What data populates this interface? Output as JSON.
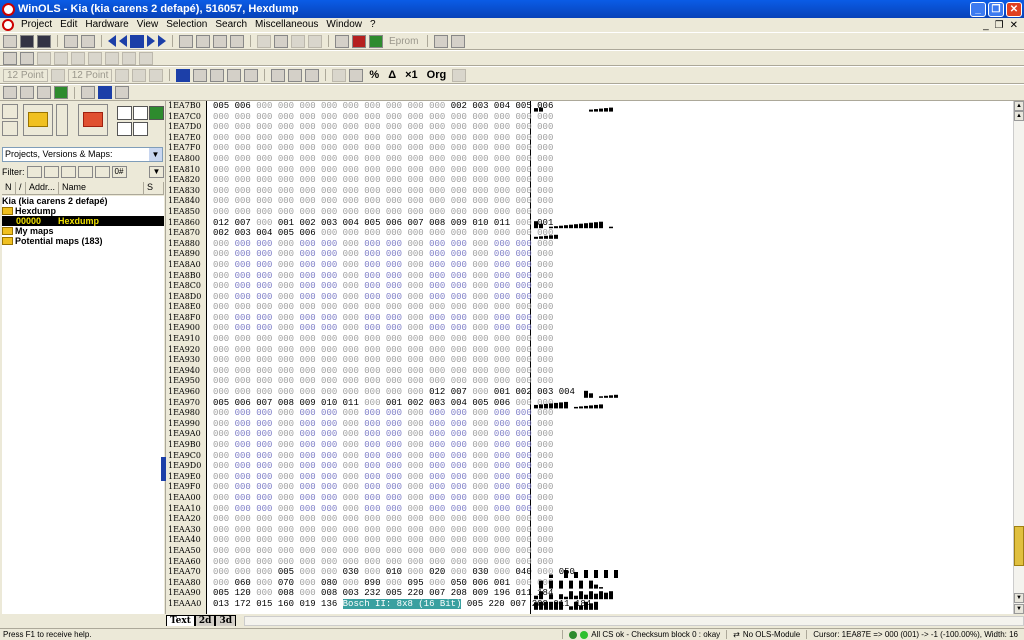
{
  "window": {
    "title": "WinOLS - Kia (kia carens 2 defapé), 516057, Hexdump",
    "minimize": "_",
    "restore": "❐",
    "close": "✕"
  },
  "menu": {
    "items": [
      "Project",
      "Edit",
      "Hardware",
      "View",
      "Selection",
      "Search",
      "Miscellaneous",
      "Window",
      "?"
    ],
    "mdi_controls": [
      "_",
      "❐",
      "✕"
    ]
  },
  "toolbar": {
    "eprom_label": "Eprom",
    "font_size_1": "12 Point",
    "font_size_2": "12 Point",
    "btn_x1": "×1",
    "btn_org": "Org",
    "btn_percent": "%"
  },
  "projects": {
    "combo_value": "Projects, Versions & Maps:",
    "filter_label": "Filter:",
    "filter_btn_0": "0#",
    "columns": [
      "N",
      "/",
      "Addr...",
      "Name",
      "S"
    ],
    "tree": {
      "project": "Kia (kia carens 2 defapé)",
      "hexdump_folder": "Hexdump",
      "hexdump_addr": "00000",
      "hexdump_name": "Hexdump",
      "my_maps": "My maps",
      "potential_maps": "Potential maps (183)"
    }
  },
  "hex": {
    "addresses": [
      "1EA7B0",
      "1EA7C0",
      "1EA7D0",
      "1EA7E0",
      "1EA7F0",
      "1EA800",
      "1EA810",
      "1EA820",
      "1EA830",
      "1EA840",
      "1EA850",
      "1EA860",
      "1EA870",
      "1EA880",
      "1EA890",
      "1EA8A0",
      "1EA8B0",
      "1EA8C0",
      "1EA8D0",
      "1EA8E0",
      "1EA8F0",
      "1EA900",
      "1EA910",
      "1EA920",
      "1EA930",
      "1EA940",
      "1EA950",
      "1EA960",
      "1EA970",
      "1EA980",
      "1EA990",
      "1EA9A0",
      "1EA9B0",
      "1EA9C0",
      "1EA9D0",
      "1EA9E0",
      "1EA9F0",
      "1EAA00",
      "1EAA10",
      "1EAA20",
      "1EAA30",
      "1EAA40",
      "1EAA50",
      "1EAA60",
      "1EAA70",
      "1EAA80",
      "1EAA90",
      "1EAAA0"
    ],
    "rows": [
      [
        "005",
        "006",
        "000",
        "000",
        "000",
        "000",
        "000",
        "000",
        "000",
        "000",
        "000",
        "002",
        "003",
        "004",
        "005",
        "006"
      ],
      [
        "000",
        "000",
        "000",
        "000",
        "000",
        "000",
        "000",
        "000",
        "000",
        "000",
        "000",
        "000",
        "000",
        "000",
        "000",
        "000"
      ],
      [
        "000",
        "000",
        "000",
        "000",
        "000",
        "000",
        "000",
        "000",
        "000",
        "000",
        "000",
        "000",
        "000",
        "000",
        "000",
        "000"
      ],
      [
        "000",
        "000",
        "000",
        "000",
        "000",
        "000",
        "000",
        "000",
        "000",
        "000",
        "000",
        "000",
        "000",
        "000",
        "000",
        "000"
      ],
      [
        "000",
        "000",
        "000",
        "000",
        "000",
        "000",
        "000",
        "000",
        "000",
        "000",
        "000",
        "000",
        "000",
        "000",
        "000",
        "000"
      ],
      [
        "000",
        "000",
        "000",
        "000",
        "000",
        "000",
        "000",
        "000",
        "000",
        "000",
        "000",
        "000",
        "000",
        "000",
        "000",
        "000"
      ],
      [
        "000",
        "000",
        "000",
        "000",
        "000",
        "000",
        "000",
        "000",
        "000",
        "000",
        "000",
        "000",
        "000",
        "000",
        "000",
        "000"
      ],
      [
        "000",
        "000",
        "000",
        "000",
        "000",
        "000",
        "000",
        "000",
        "000",
        "000",
        "000",
        "000",
        "000",
        "000",
        "000",
        "000"
      ],
      [
        "000",
        "000",
        "000",
        "000",
        "000",
        "000",
        "000",
        "000",
        "000",
        "000",
        "000",
        "000",
        "000",
        "000",
        "000",
        "000"
      ],
      [
        "000",
        "000",
        "000",
        "000",
        "000",
        "000",
        "000",
        "000",
        "000",
        "000",
        "000",
        "000",
        "000",
        "000",
        "000",
        "000"
      ],
      [
        "000",
        "000",
        "000",
        "000",
        "000",
        "000",
        "000",
        "000",
        "000",
        "000",
        "000",
        "000",
        "000",
        "000",
        "000",
        "000"
      ],
      [
        "012",
        "007",
        "000",
        "001",
        "002",
        "003",
        "004",
        "005",
        "006",
        "007",
        "008",
        "009",
        "010",
        "011",
        "000",
        "001"
      ],
      [
        "002",
        "003",
        "004",
        "005",
        "006",
        "000",
        "000",
        "000",
        "000",
        "000",
        "000",
        "000",
        "000",
        "000",
        "000",
        "000"
      ],
      [
        "000",
        "000",
        "000",
        "000",
        "000",
        "000",
        "000",
        "000",
        "000",
        "000",
        "000",
        "000",
        "000",
        "000",
        "000",
        "000"
      ],
      [
        "000",
        "000",
        "000",
        "000",
        "000",
        "000",
        "000",
        "000",
        "000",
        "000",
        "000",
        "000",
        "000",
        "000",
        "000",
        "000"
      ],
      [
        "000",
        "000",
        "000",
        "000",
        "000",
        "000",
        "000",
        "000",
        "000",
        "000",
        "000",
        "000",
        "000",
        "000",
        "000",
        "000"
      ],
      [
        "000",
        "000",
        "000",
        "000",
        "000",
        "000",
        "000",
        "000",
        "000",
        "000",
        "000",
        "000",
        "000",
        "000",
        "000",
        "000"
      ],
      [
        "000",
        "000",
        "000",
        "000",
        "000",
        "000",
        "000",
        "000",
        "000",
        "000",
        "000",
        "000",
        "000",
        "000",
        "000",
        "000"
      ],
      [
        "000",
        "000",
        "000",
        "000",
        "000",
        "000",
        "000",
        "000",
        "000",
        "000",
        "000",
        "000",
        "000",
        "000",
        "000",
        "000"
      ],
      [
        "000",
        "000",
        "000",
        "000",
        "000",
        "000",
        "000",
        "000",
        "000",
        "000",
        "000",
        "000",
        "000",
        "000",
        "000",
        "000"
      ],
      [
        "000",
        "000",
        "000",
        "000",
        "000",
        "000",
        "000",
        "000",
        "000",
        "000",
        "000",
        "000",
        "000",
        "000",
        "000",
        "000"
      ],
      [
        "000",
        "000",
        "000",
        "000",
        "000",
        "000",
        "000",
        "000",
        "000",
        "000",
        "000",
        "000",
        "000",
        "000",
        "000",
        "000"
      ],
      [
        "000",
        "000",
        "000",
        "000",
        "000",
        "000",
        "000",
        "000",
        "000",
        "000",
        "000",
        "000",
        "000",
        "000",
        "000",
        "000"
      ],
      [
        "000",
        "000",
        "000",
        "000",
        "000",
        "000",
        "000",
        "000",
        "000",
        "000",
        "000",
        "000",
        "000",
        "000",
        "000",
        "000"
      ],
      [
        "000",
        "000",
        "000",
        "000",
        "000",
        "000",
        "000",
        "000",
        "000",
        "000",
        "000",
        "000",
        "000",
        "000",
        "000",
        "000"
      ],
      [
        "000",
        "000",
        "000",
        "000",
        "000",
        "000",
        "000",
        "000",
        "000",
        "000",
        "000",
        "000",
        "000",
        "000",
        "000",
        "000"
      ],
      [
        "000",
        "000",
        "000",
        "000",
        "000",
        "000",
        "000",
        "000",
        "000",
        "000",
        "000",
        "000",
        "000",
        "000",
        "000",
        "000"
      ],
      [
        "000",
        "000",
        "000",
        "000",
        "000",
        "000",
        "000",
        "000",
        "000",
        "000",
        "012",
        "007",
        "000",
        "001",
        "002",
        "003",
        "004"
      ],
      [
        "005",
        "006",
        "007",
        "008",
        "009",
        "010",
        "011",
        "000",
        "001",
        "002",
        "003",
        "004",
        "005",
        "006",
        "000",
        "000"
      ],
      [
        "000",
        "000",
        "000",
        "000",
        "000",
        "000",
        "000",
        "000",
        "000",
        "000",
        "000",
        "000",
        "000",
        "000",
        "000",
        "000"
      ],
      [
        "000",
        "000",
        "000",
        "000",
        "000",
        "000",
        "000",
        "000",
        "000",
        "000",
        "000",
        "000",
        "000",
        "000",
        "000",
        "000"
      ],
      [
        "000",
        "000",
        "000",
        "000",
        "000",
        "000",
        "000",
        "000",
        "000",
        "000",
        "000",
        "000",
        "000",
        "000",
        "000",
        "000"
      ],
      [
        "000",
        "000",
        "000",
        "000",
        "000",
        "000",
        "000",
        "000",
        "000",
        "000",
        "000",
        "000",
        "000",
        "000",
        "000",
        "000"
      ],
      [
        "000",
        "000",
        "000",
        "000",
        "000",
        "000",
        "000",
        "000",
        "000",
        "000",
        "000",
        "000",
        "000",
        "000",
        "000",
        "000"
      ],
      [
        "000",
        "000",
        "000",
        "000",
        "000",
        "000",
        "000",
        "000",
        "000",
        "000",
        "000",
        "000",
        "000",
        "000",
        "000",
        "000"
      ],
      [
        "000",
        "000",
        "000",
        "000",
        "000",
        "000",
        "000",
        "000",
        "000",
        "000",
        "000",
        "000",
        "000",
        "000",
        "000",
        "000"
      ],
      [
        "000",
        "000",
        "000",
        "000",
        "000",
        "000",
        "000",
        "000",
        "000",
        "000",
        "000",
        "000",
        "000",
        "000",
        "000",
        "000"
      ],
      [
        "000",
        "000",
        "000",
        "000",
        "000",
        "000",
        "000",
        "000",
        "000",
        "000",
        "000",
        "000",
        "000",
        "000",
        "000",
        "000"
      ],
      [
        "000",
        "000",
        "000",
        "000",
        "000",
        "000",
        "000",
        "000",
        "000",
        "000",
        "000",
        "000",
        "000",
        "000",
        "000",
        "000"
      ],
      [
        "000",
        "000",
        "000",
        "000",
        "000",
        "000",
        "000",
        "000",
        "000",
        "000",
        "000",
        "000",
        "000",
        "000",
        "000",
        "000"
      ],
      [
        "000",
        "000",
        "000",
        "000",
        "000",
        "000",
        "000",
        "000",
        "000",
        "000",
        "000",
        "000",
        "000",
        "000",
        "000",
        "000"
      ],
      [
        "000",
        "000",
        "000",
        "000",
        "000",
        "000",
        "000",
        "000",
        "000",
        "000",
        "000",
        "000",
        "000",
        "000",
        "000",
        "000"
      ],
      [
        "000",
        "000",
        "000",
        "000",
        "000",
        "000",
        "000",
        "000",
        "000",
        "000",
        "000",
        "000",
        "000",
        "000",
        "000",
        "000"
      ],
      [
        "000",
        "000",
        "000",
        "000",
        "000",
        "000",
        "000",
        "000",
        "000",
        "000",
        "000",
        "000",
        "000",
        "000",
        "000",
        "000"
      ],
      [
        "000",
        "000",
        "000",
        "005",
        "000",
        "000",
        "030",
        "000",
        "010",
        "000",
        "020",
        "000",
        "030",
        "000",
        "040",
        "000",
        "050"
      ],
      [
        "000",
        "060",
        "000",
        "070",
        "000",
        "080",
        "000",
        "090",
        "000",
        "095",
        "000",
        "050",
        "006",
        "001",
        "000",
        "000"
      ],
      [
        "005",
        "120",
        "000",
        "008",
        "000",
        "008",
        "003",
        "232",
        "005",
        "220",
        "007",
        "208",
        "009",
        "196",
        "011",
        "184"
      ],
      [
        "013",
        "172",
        "015",
        "160",
        "019",
        "136",
        "Bosch II: 8x8 (16 Bit)",
        "005",
        "220",
        "007",
        "208",
        "011",
        "184"
      ]
    ],
    "highlight_label": "Bosch II: 8x8 (16 Bit)"
  },
  "tabs": [
    "Text",
    "2d",
    "3d"
  ],
  "status": {
    "help": "Press F1 to receive help.",
    "checksum": "All CS ok - Checksum block 0 : okay",
    "module": "No OLS-Module",
    "cursor": "Cursor: 1EA87E => 000 (001) -> -1 (-100.00%), Width: 16"
  },
  "colors": {
    "title_bg": "#0a5ce6",
    "selection_bg": "#000000",
    "selection_fg": "#f0e000",
    "highlight": "#3aa0a0"
  }
}
